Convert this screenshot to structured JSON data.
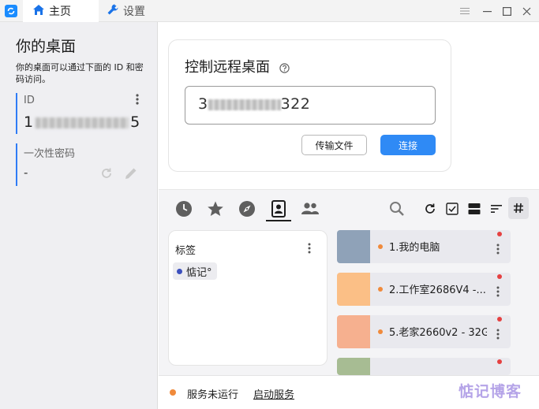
{
  "titlebar": {
    "tabs": [
      {
        "label": "主页",
        "icon": "home-icon"
      },
      {
        "label": "设置",
        "icon": "wrench-icon"
      }
    ],
    "controls": [
      "menu-icon",
      "minimize-icon",
      "maximize-icon",
      "close-icon"
    ]
  },
  "left": {
    "title": "你的桌面",
    "description": "你的桌面可以通过下面的 ID 和密码访问。",
    "id_label": "ID",
    "id_prefix": "1",
    "id_suffix": "5",
    "password_label": "一次性密码",
    "password_value": "-"
  },
  "control": {
    "title": "控制远程桌面",
    "input_prefix": "3",
    "input_suffix": "322",
    "transfer_button": "传输文件",
    "connect_button": "连接"
  },
  "toolbar": {
    "left_icons": [
      "history-icon",
      "star-icon",
      "compass-icon",
      "address-book-icon",
      "group-icon"
    ],
    "active_index": 3,
    "right_icons": [
      "search-icon",
      "refresh-icon",
      "checkbox-icon",
      "view-toggle-icon",
      "sort-icon",
      "hash-icon"
    ]
  },
  "tags": {
    "title": "标签",
    "items": [
      {
        "label": "惦记°",
        "color": "#3b4fbd"
      }
    ]
  },
  "peers": [
    {
      "name": "1.我的电脑",
      "thumb_color": "#8fa2b8"
    },
    {
      "name": "2.工作室2686V4 -...",
      "thumb_color": "#fbbf86"
    },
    {
      "name": "5.老家2660v2 - 32G",
      "thumb_color": "#f6b08f"
    },
    {
      "name": "",
      "thumb_color": "#a7bc93"
    }
  ],
  "status": {
    "text": "服务未运行",
    "link": "启动服务",
    "dot_color": "#f08a3b",
    "watermark": "惦记博客"
  },
  "colors": {
    "accent": "#2f8af5",
    "status_red": "#e54141"
  }
}
